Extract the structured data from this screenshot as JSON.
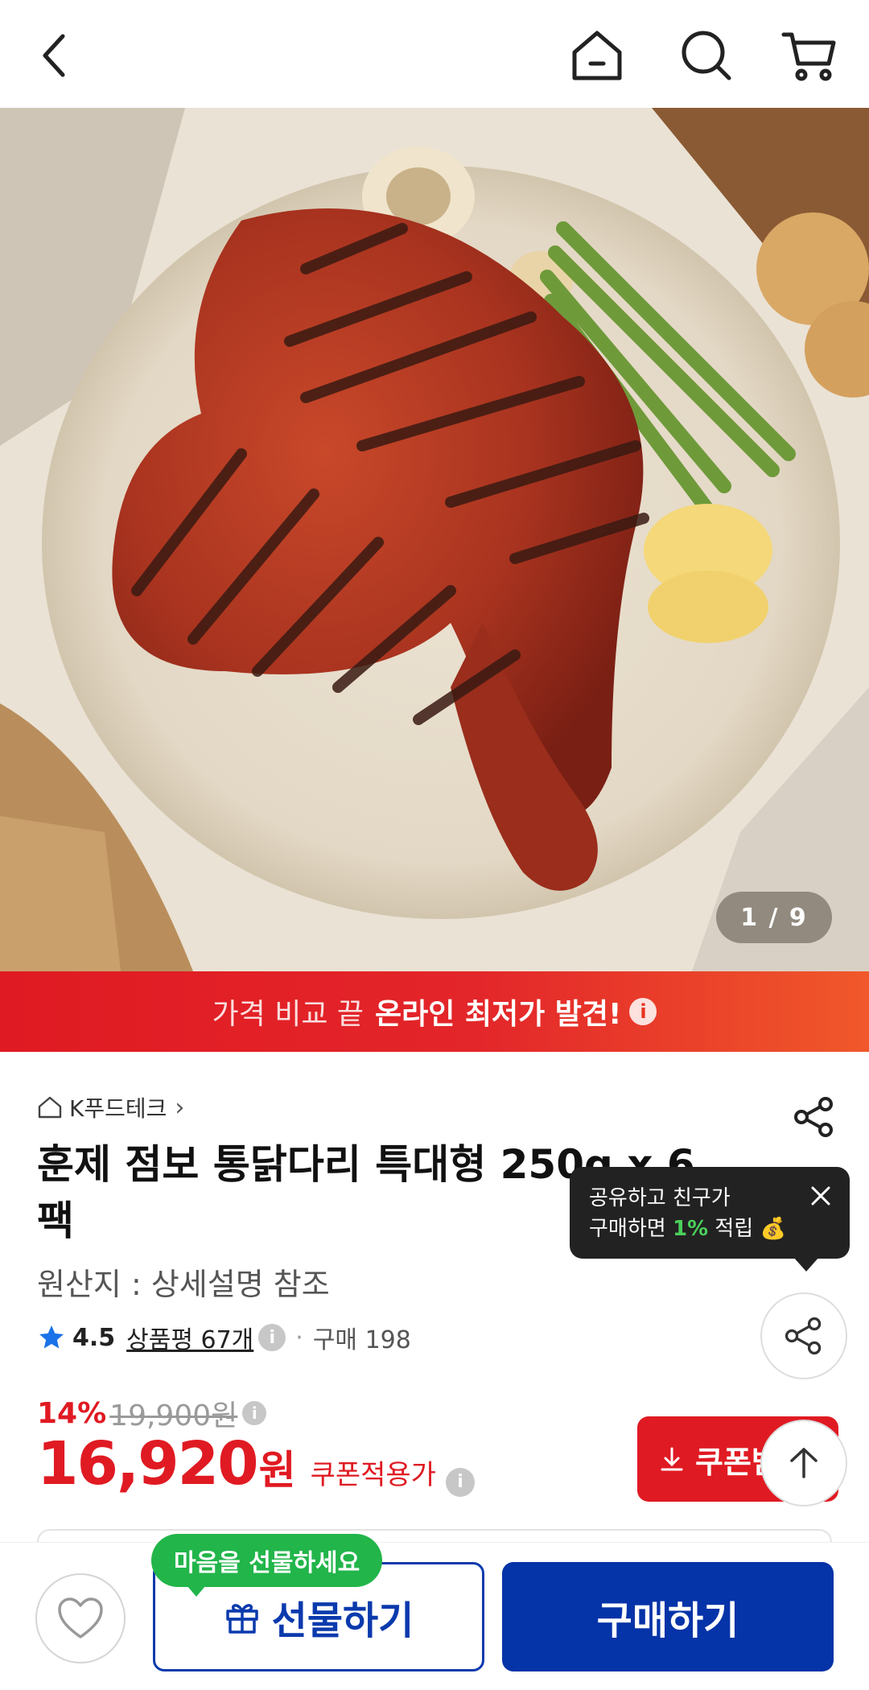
{
  "topbar": {
    "back_icon": "chevron-left-icon",
    "home_icon": "home-icon",
    "search_icon": "search-icon",
    "cart_icon": "cart-icon"
  },
  "gallery": {
    "indicator": "1 / 9"
  },
  "banner": {
    "light_text": "가격 비교 끝",
    "strong_text": "온라인 최저가 발견!",
    "info_glyph": "i"
  },
  "product": {
    "seller": "K푸드테크",
    "title": "훈제 점보 통닭다리 특대형 250g x 6팩",
    "origin": "원산지 : 상세설명 참조",
    "rating": "4.5",
    "reviews": "상품평 67개",
    "purchases": "구매 198",
    "discount_pct": "14%",
    "original_price": "19,900원",
    "price": "16,920",
    "price_unit": "원",
    "coupon_label": "쿠폰적용가",
    "coupon_button": "쿠폰받기"
  },
  "share_tooltip": {
    "line1": "공유하고 친구가",
    "line2_prefix": "구매하면 ",
    "line2_highlight": "1%",
    "line2_suffix": " 적립"
  },
  "bottom": {
    "gift_bubble": "마음을 선물하세요",
    "gift_button": "선물하기",
    "buy_button": "구매하기"
  },
  "colors": {
    "accent_red": "#e01a22",
    "brand_blue": "#0533a8",
    "bubble_green": "#22b54a"
  }
}
